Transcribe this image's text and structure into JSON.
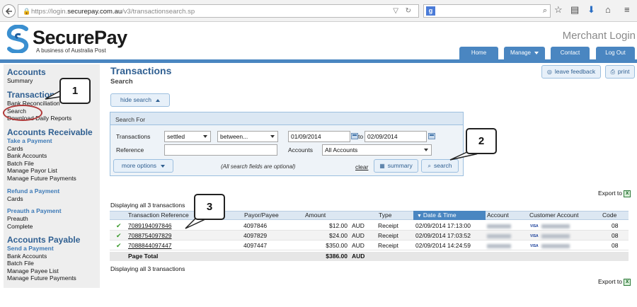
{
  "browser": {
    "url_prefix": "https://login.",
    "url_domain": "securepay.com.au",
    "url_suffix": "/v3/transactionsearch.sp",
    "search_engine_icon": "google-icon"
  },
  "header": {
    "logo_name": "SecurePay",
    "logo_tagline": "A business of Australia Post",
    "merchant_title": "Merchant Login",
    "nav": {
      "home": "Home",
      "manage": "Manage",
      "contact": "Contact",
      "logout": "Log Out"
    }
  },
  "sidebar": {
    "accounts": {
      "heading": "Accounts",
      "summary": "Summary"
    },
    "transactions": {
      "heading": "Transactions",
      "bank_reconciliation": "Bank Reconciliation",
      "search": "Search",
      "download_daily_reports": "Download Daily Reports"
    },
    "accounts_receivable": {
      "heading": "Accounts Receivable",
      "take_payment": "Take a Payment",
      "cards": "Cards",
      "bank_accounts": "Bank Accounts",
      "batch_file": "Batch File",
      "manage_payor_list": "Manage Payor List",
      "manage_future_payments": "Manage Future Payments",
      "refund_payment": "Refund a Payment",
      "refund_cards": "Cards",
      "preauth_payment": "Preauth a Payment",
      "preauth": "Preauth",
      "complete": "Complete"
    },
    "accounts_payable": {
      "heading": "Accounts Payable",
      "send_payment": "Send a Payment",
      "bank_accounts": "Bank Accounts",
      "batch_file": "Batch File",
      "manage_payee_list": "Manage Payee List",
      "manage_future_payments": "Manage Future Payments"
    }
  },
  "main": {
    "title": "Transactions",
    "subtitle": "Search",
    "leave_feedback": "leave feedback",
    "print": "print",
    "hide_search": "hide search",
    "search_for": "Search For",
    "transactions_label": "Transactions",
    "status_value": "settled",
    "range_value": "between...",
    "date_from": "01/09/2014",
    "to_label": "to",
    "date_to": "02/09/2014",
    "reference_label": "Reference",
    "reference_value": "",
    "accounts_label": "Accounts",
    "accounts_value": "All Accounts",
    "more_options": "more options",
    "optional_note": "(All search fields are optional)",
    "clear": "clear",
    "summary": "summary",
    "search": "search",
    "export_to": "Export to",
    "displaying": "Displaying all 3 transactions"
  },
  "table": {
    "columns": [
      "Transaction Reference",
      "Payor/Payee",
      "Amount",
      "",
      "Type",
      "Date & Time",
      "Account",
      "Customer Account",
      "Code"
    ],
    "rows": [
      {
        "ref": "7089194097846",
        "payor": "4097846",
        "amount": "$12.00",
        "currency": "AUD",
        "type": "Receipt",
        "datetime": "02/09/2014 17:13:00",
        "code": "08"
      },
      {
        "ref": "7088754097829",
        "payor": "4097829",
        "amount": "$24.00",
        "currency": "AUD",
        "type": "Receipt",
        "datetime": "02/09/2014 17:03:52",
        "code": "08"
      },
      {
        "ref": "7088844097447",
        "payor": "4097447",
        "amount": "$350.00",
        "currency": "AUD",
        "type": "Receipt",
        "datetime": "02/09/2014 14:24:59",
        "code": "08"
      }
    ],
    "page_total_label": "Page Total",
    "page_total": "$386.00",
    "page_total_currency": "AUD",
    "visa_label": "VISA"
  },
  "callouts": {
    "one": "1",
    "two": "2",
    "three": "3"
  },
  "colors": {
    "brand_blue": "#4a86c1",
    "heading_blue": "#2f5f91",
    "highlight_ring": "#b03a3a"
  }
}
